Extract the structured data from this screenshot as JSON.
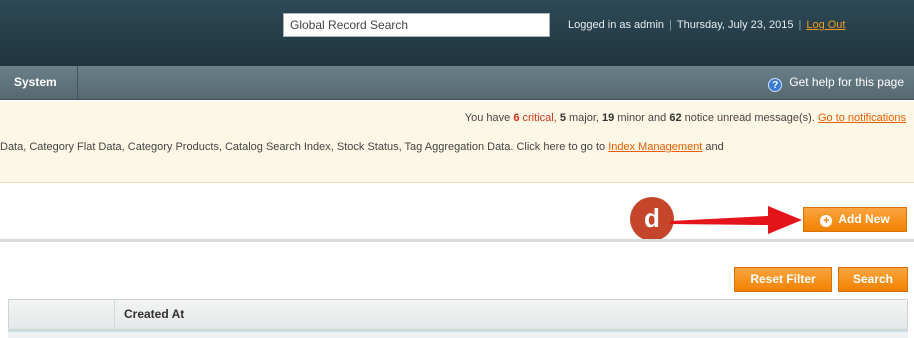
{
  "header": {
    "search_value": "Global Record Search",
    "logged_in_text": "Logged in as admin",
    "date_text": "Thursday, July 23, 2015",
    "logout_label": "Log Out"
  },
  "nav": {
    "system_label": "System",
    "help_label": "Get help for this page"
  },
  "notifications": {
    "prefix": "You have",
    "critical_count": "6",
    "critical_word": "critical,",
    "major_count": "5",
    "major_word": "major,",
    "minor_count": "19",
    "minor_word": "minor and",
    "notice_count": "62",
    "notice_word": "notice unread message(s).",
    "link_label": "Go to notifications"
  },
  "index_notice": {
    "text": "Data, Category Flat Data, Category Products, Catalog Search Index, Stock Status, Tag Aggregation Data. Click here to go to",
    "link_label": "Index Management",
    "suffix": "and"
  },
  "actions": {
    "add_new_label": "Add New",
    "reset_filter_label": "Reset Filter",
    "search_label": "Search"
  },
  "grid": {
    "column_created_at": "Created At"
  },
  "annotation": {
    "letter": "d"
  },
  "colors": {
    "header_bg": "#2d4a57",
    "nav_bg": "#5f737a",
    "button_orange": "#f18200",
    "link_orange": "#eb5e00",
    "notice_bg": "#fdf7e5",
    "annotation_red": "#e4141b"
  }
}
